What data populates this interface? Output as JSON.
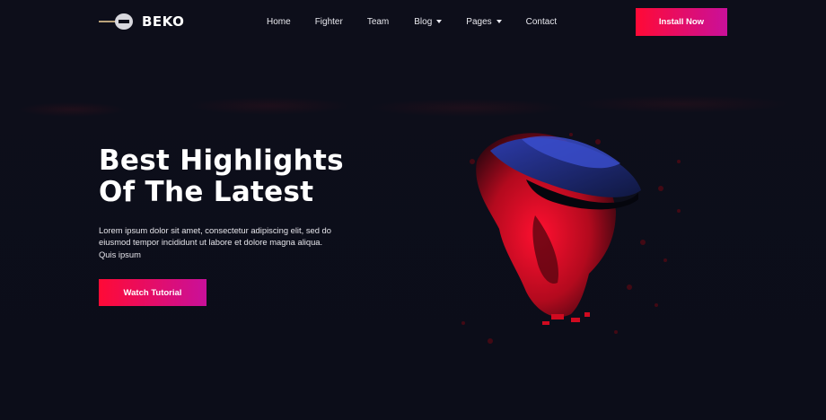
{
  "brand": {
    "name": "BEKO"
  },
  "nav": {
    "items": [
      {
        "label": "Home",
        "has_dropdown": false
      },
      {
        "label": "Fighter",
        "has_dropdown": false
      },
      {
        "label": "Team",
        "has_dropdown": false
      },
      {
        "label": "Blog",
        "has_dropdown": true
      },
      {
        "label": "Pages",
        "has_dropdown": true
      },
      {
        "label": "Contact",
        "has_dropdown": false
      }
    ],
    "cta_label": "Install Now"
  },
  "hero": {
    "title_line1": "Best Highlights",
    "title_line2": "Of The Latest",
    "description": "Lorem ipsum dolor sit amet, consectetur adipiscing elit, sed do eiusmod tempor incididunt ut labore et dolore magna aliqua. Quis ipsum",
    "button_label": "Watch Tutorial",
    "image": "vr-headset-dispersion-image"
  },
  "colors": {
    "background": "#0d0e1a",
    "accent_start": "#ff0a36",
    "accent_end": "#c9109a"
  }
}
